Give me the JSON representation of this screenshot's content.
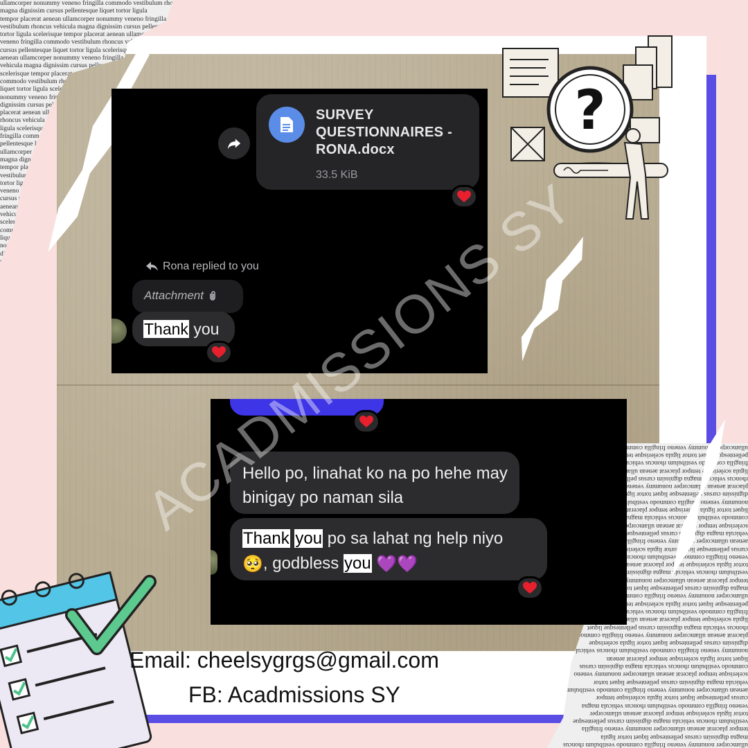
{
  "watermark": "ACADMISSIONS SY",
  "screenshot_1": {
    "file": {
      "name": "SURVEY QUESTIONNAIRES - RONA.docx",
      "size": "33.5 KiB",
      "icon": "document-icon"
    },
    "reply_label": "Rona replied to you",
    "quoted": "Attachment",
    "message": {
      "highlight": "Thank",
      "rest": "you"
    }
  },
  "screenshot_2": {
    "message_1": "Hello po, linahat ko na po hehe may binigay po naman sila",
    "message_2": {
      "part_1": "Thank",
      "part_2": "you",
      "part_3": "po sa lahat ng help niyo",
      "emoji_1": "🥺",
      "part_4": ", godbless",
      "part_5": "you",
      "emoji_2": "💜💜"
    }
  },
  "contact": {
    "email": "Email: cheelsygrgs@gmail.com",
    "fb": "FB: Acadmissions SY"
  },
  "colors": {
    "purple": "#5a4de4",
    "heart": "#e8202e",
    "bubble": "#2c2c2e",
    "file_icon": "#5b8de8",
    "blue_bar": "#3d35e6"
  }
}
